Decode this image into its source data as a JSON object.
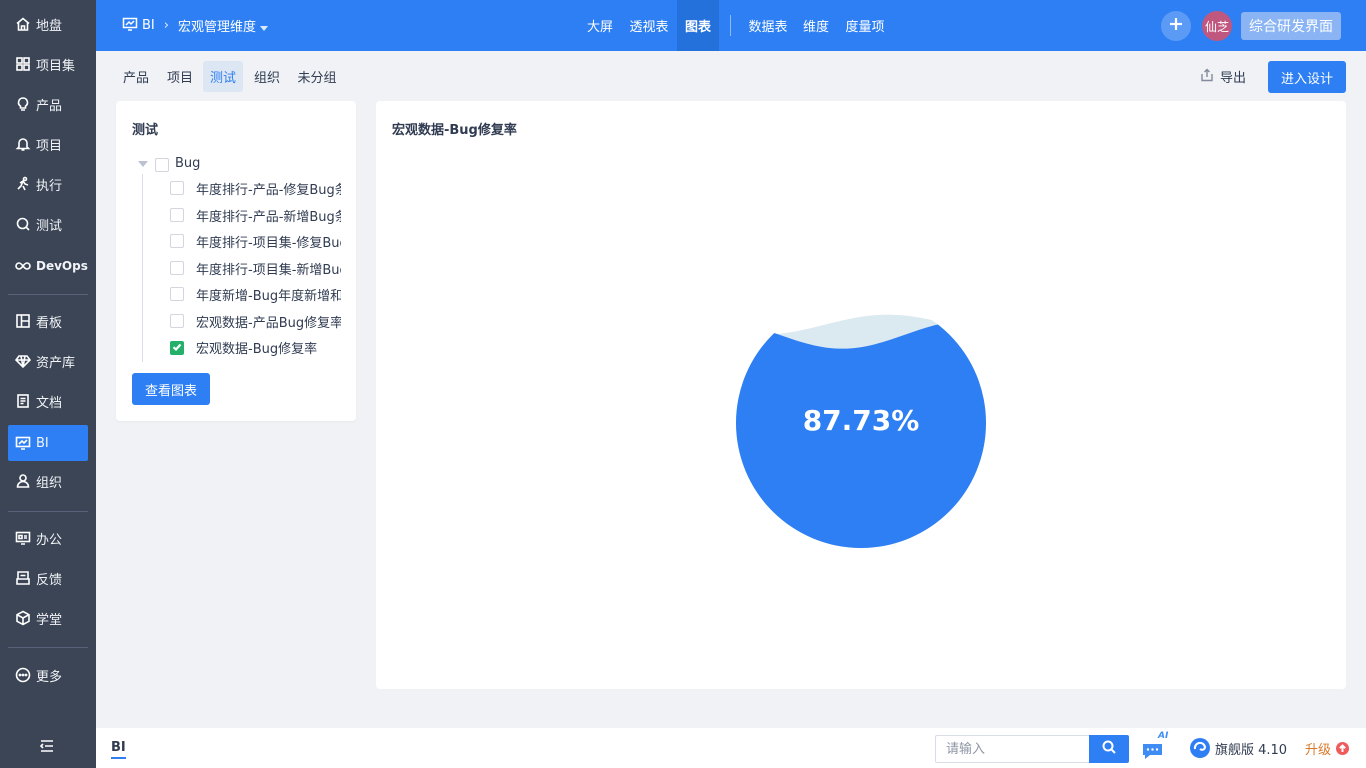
{
  "sidebar": {
    "items": [
      {
        "label": "地盘",
        "icon": "home-icon"
      },
      {
        "label": "项目集",
        "icon": "grid-icon"
      },
      {
        "label": "产品",
        "icon": "bulb-icon"
      },
      {
        "label": "项目",
        "icon": "bell-icon"
      },
      {
        "label": "执行",
        "icon": "run-icon"
      },
      {
        "label": "测试",
        "icon": "search-bug-icon"
      },
      {
        "label": "DevOps",
        "icon": "infinity-icon"
      },
      {
        "label": "看板",
        "icon": "kanban-icon"
      },
      {
        "label": "资产库",
        "icon": "diamond-icon"
      },
      {
        "label": "文档",
        "icon": "document-icon"
      },
      {
        "label": "BI",
        "icon": "bi-monitor-icon",
        "active": true
      },
      {
        "label": "组织",
        "icon": "user-icon"
      },
      {
        "label": "办公",
        "icon": "office-icon"
      },
      {
        "label": "反馈",
        "icon": "feedback-icon"
      },
      {
        "label": "学堂",
        "icon": "cube-icon"
      },
      {
        "label": "更多",
        "icon": "more-icon"
      }
    ]
  },
  "topbar": {
    "app": "BI",
    "section": "宏观管理维度",
    "nav": [
      "大屏",
      "透视表",
      "图表",
      "数据表",
      "维度",
      "度量项"
    ],
    "active_nav": "图表",
    "avatar": "仙芝",
    "switch_label": "综合研发界面"
  },
  "subtabs": [
    "产品",
    "项目",
    "测试",
    "组织",
    "未分组"
  ],
  "active_subtab": "测试",
  "toolbar": {
    "export_label": "导出",
    "design_label": "进入设计"
  },
  "left_panel": {
    "title": "测试",
    "root": "Bug",
    "items": [
      {
        "label": "年度排行-产品-修复Bug条",
        "checked": false
      },
      {
        "label": "年度排行-产品-新增Bug条",
        "checked": false
      },
      {
        "label": "年度排行-项目集-修复Bug",
        "checked": false
      },
      {
        "label": "年度排行-项目集-新增Bug",
        "checked": false
      },
      {
        "label": "年度新增-Bug年度新增和",
        "checked": false
      },
      {
        "label": "宏观数据-产品Bug修复率",
        "checked": false
      },
      {
        "label": "宏观数据-Bug修复率",
        "checked": true
      }
    ],
    "view_button": "查看图表"
  },
  "chart_panel": {
    "title": "宏观数据-Bug修复率"
  },
  "chart_data": {
    "type": "liquid",
    "value": 87.73,
    "value_label": "87.73%",
    "colors": {
      "fill": "#2e7ff3",
      "wave": "#dbe9f1"
    }
  },
  "bottombar": {
    "label": "BI",
    "search_placeholder": "请输入",
    "ai_badge": "AI",
    "edition": "旗舰版 4.10",
    "upgrade": "升级"
  }
}
